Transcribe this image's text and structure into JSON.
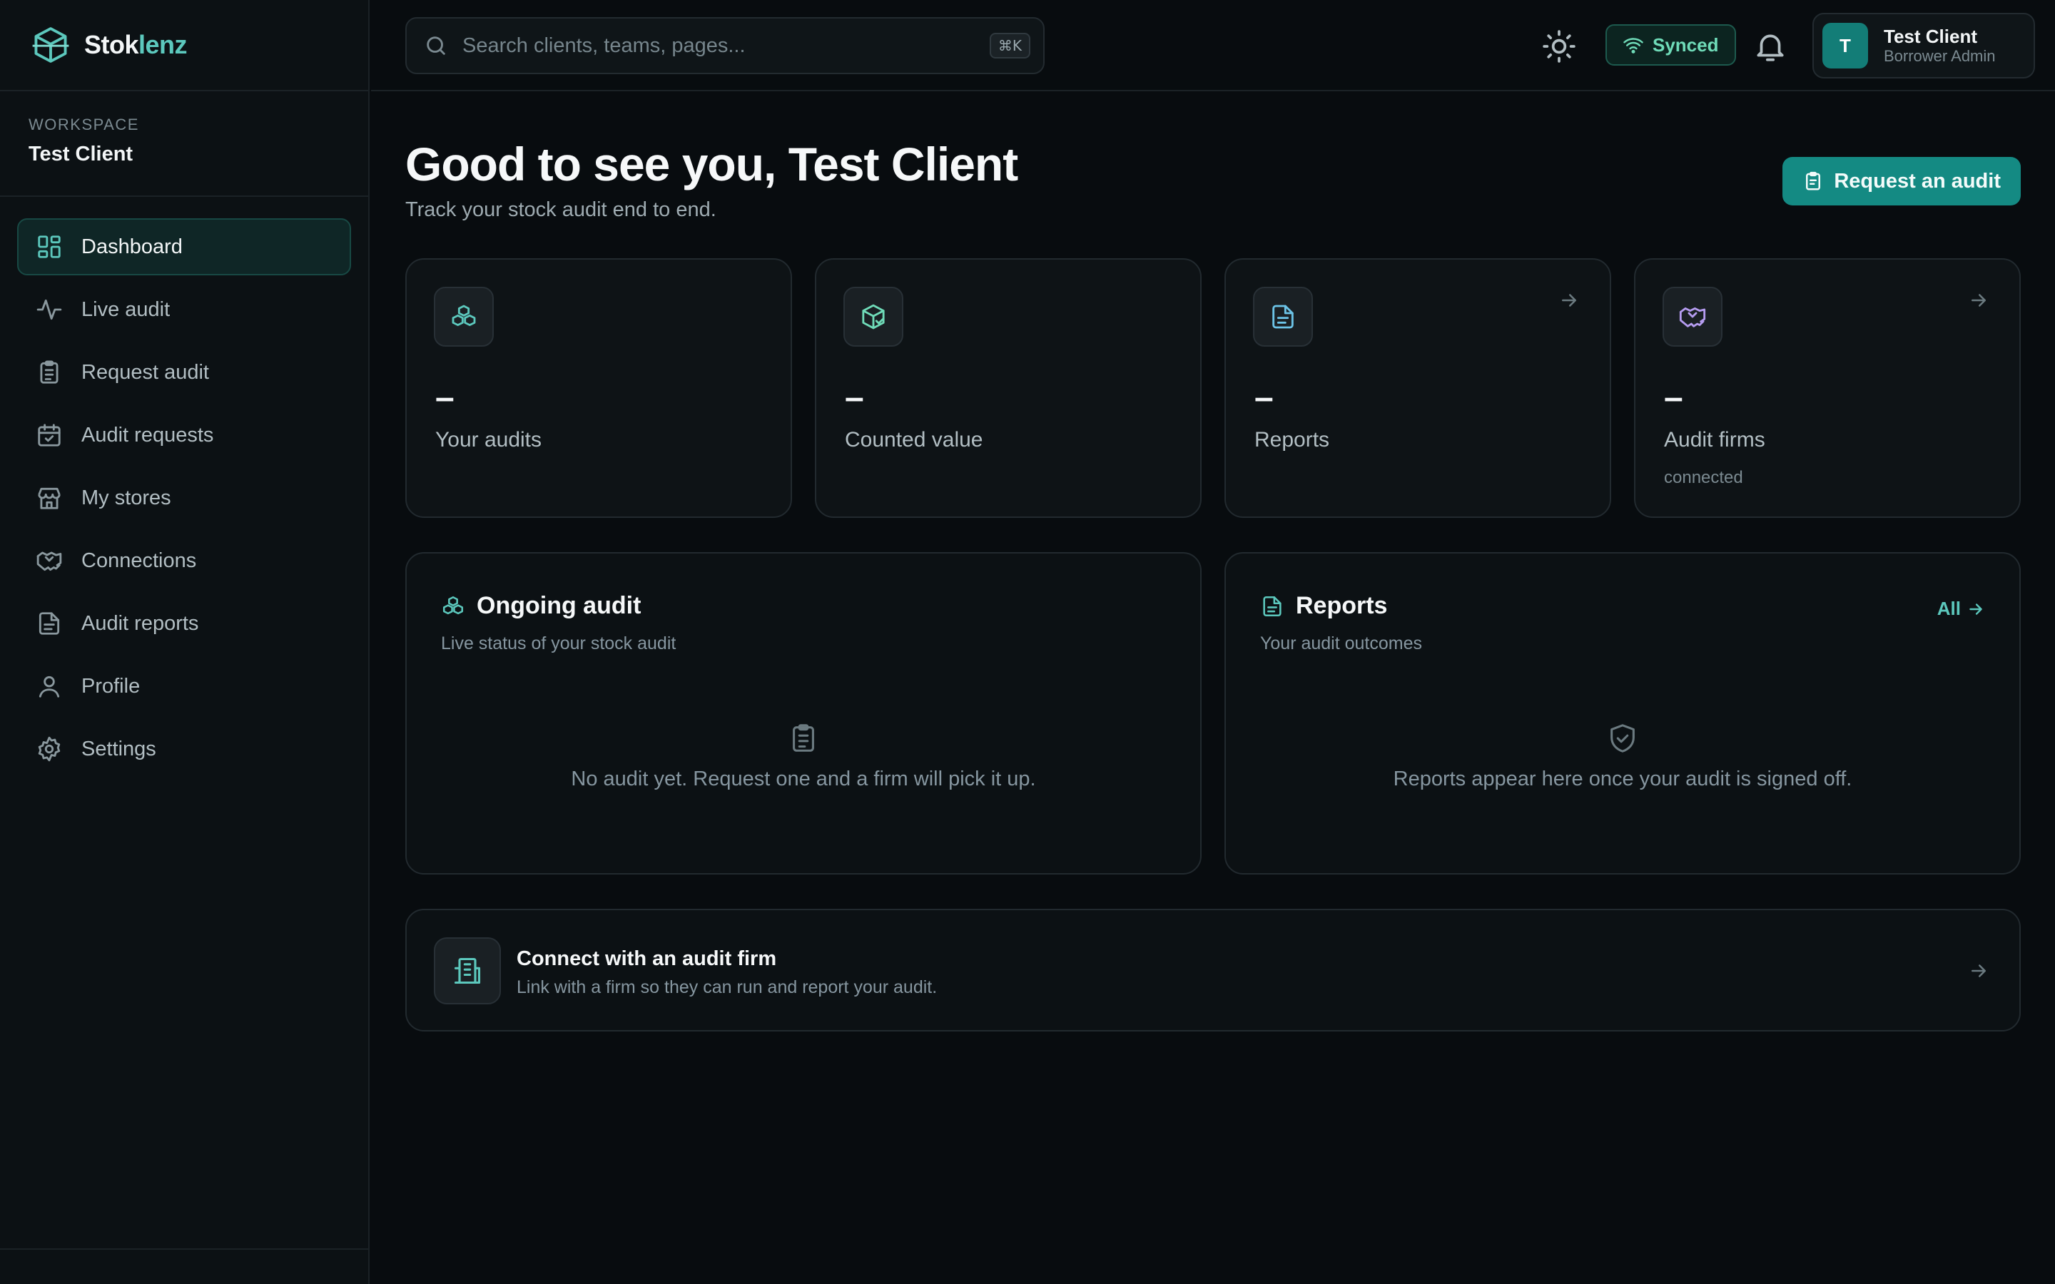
{
  "app": {
    "name_part1": "Stok",
    "name_part2": "lenz",
    "accent_color": "#5cc8bd",
    "brand_color": "#148a83"
  },
  "sidebar": {
    "workspace_label": "WORKSPACE",
    "workspace_name": "Test Client",
    "items": [
      {
        "label": "Dashboard",
        "icon": "dashboard-grid-icon",
        "active": true
      },
      {
        "label": "Live audit",
        "icon": "activity-pulse-icon"
      },
      {
        "label": "Request audit",
        "icon": "clipboard-list-icon"
      },
      {
        "label": "Audit requests",
        "icon": "calendar-check-icon"
      },
      {
        "label": "My stores",
        "icon": "store-icon"
      },
      {
        "label": "Connections",
        "icon": "handshake-icon"
      },
      {
        "label": "Audit reports",
        "icon": "file-text-icon"
      },
      {
        "label": "Profile",
        "icon": "user-icon"
      },
      {
        "label": "Settings",
        "icon": "gear-icon"
      }
    ]
  },
  "topbar": {
    "search_placeholder": "Search clients, teams, pages...",
    "search_shortcut": "⌘K",
    "sync_status": "Synced",
    "user": {
      "initial": "T",
      "name": "Test Client",
      "role": "Borrower Admin"
    }
  },
  "main": {
    "greeting": "Good to see you, Test Client",
    "subtitle": "Track your stock audit end to end.",
    "cta_label": "Request an audit",
    "stats": [
      {
        "value": "–",
        "label": "Your audits",
        "icon": "boxes-icon",
        "icon_color": "#5cc8bd"
      },
      {
        "value": "–",
        "label": "Counted value",
        "icon": "package-check-icon",
        "icon_color": "#6fdbb8"
      },
      {
        "value": "–",
        "label": "Reports",
        "icon": "file-text-icon",
        "icon_color": "#6cc4e8"
      },
      {
        "value": "–",
        "label": "Audit firms",
        "sub": "connected",
        "icon": "handshake-icon",
        "icon_color": "#b59cf0"
      }
    ],
    "ongoing": {
      "title": "Ongoing audit",
      "subtitle": "Live status of your stock audit",
      "empty": "No audit yet. Request one and a firm will pick it up."
    },
    "reports": {
      "title": "Reports",
      "subtitle": "Your audit outcomes",
      "link": "All",
      "empty": "Reports appear here once your audit is signed off."
    },
    "connect": {
      "title": "Connect with an audit firm",
      "subtitle": "Link with a firm so they can run and report your audit."
    }
  }
}
